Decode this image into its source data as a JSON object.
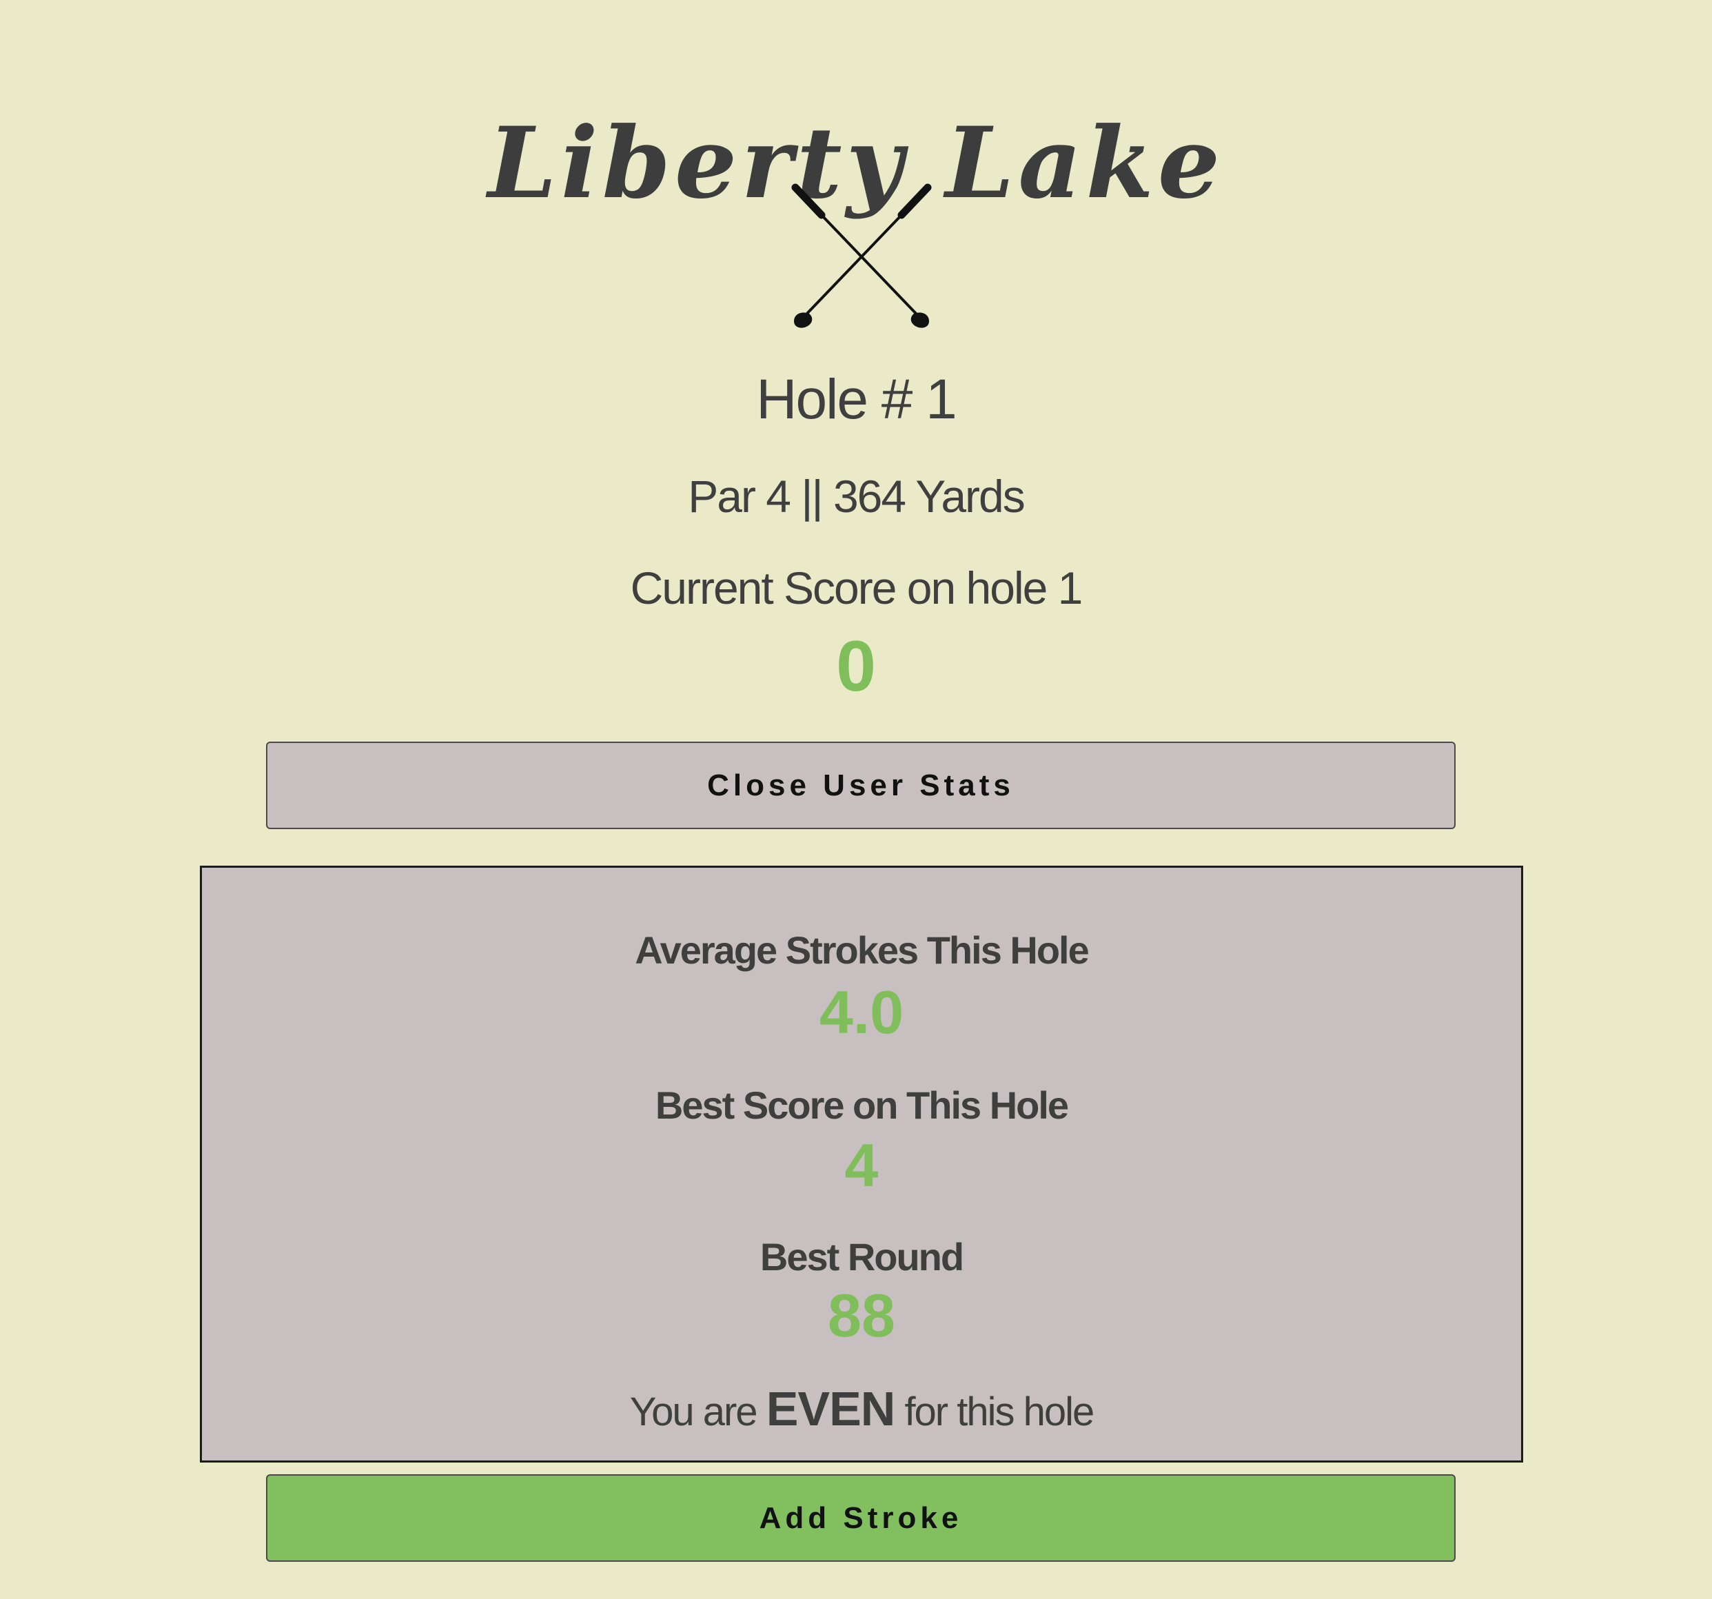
{
  "course": {
    "name": "Liberty Lake",
    "logo_icon": "crossed-golf-clubs-icon"
  },
  "hole": {
    "title": "Hole # 1",
    "info": "Par 4 || 364 Yards",
    "score_label": "Current Score on hole 1",
    "score_value": "0"
  },
  "buttons": {
    "stats_toggle_label": "Close User Stats",
    "add_stroke_label": "Add Stroke"
  },
  "stats": {
    "avg_label": "Average Strokes This Hole",
    "avg_value": "4.0",
    "best_hole_label": "Best Score on This Hole",
    "best_hole_value": "4",
    "best_round_label": "Best Round",
    "best_round_value": "88",
    "status_prefix": "You are",
    "status_word": "EVEN",
    "status_suffix": "for this hole"
  },
  "colors": {
    "background": "#eaeac8",
    "accent_green": "#80bd5b",
    "panel_gray": "#c8c0c0",
    "text_dark": "#3f3f3f"
  }
}
